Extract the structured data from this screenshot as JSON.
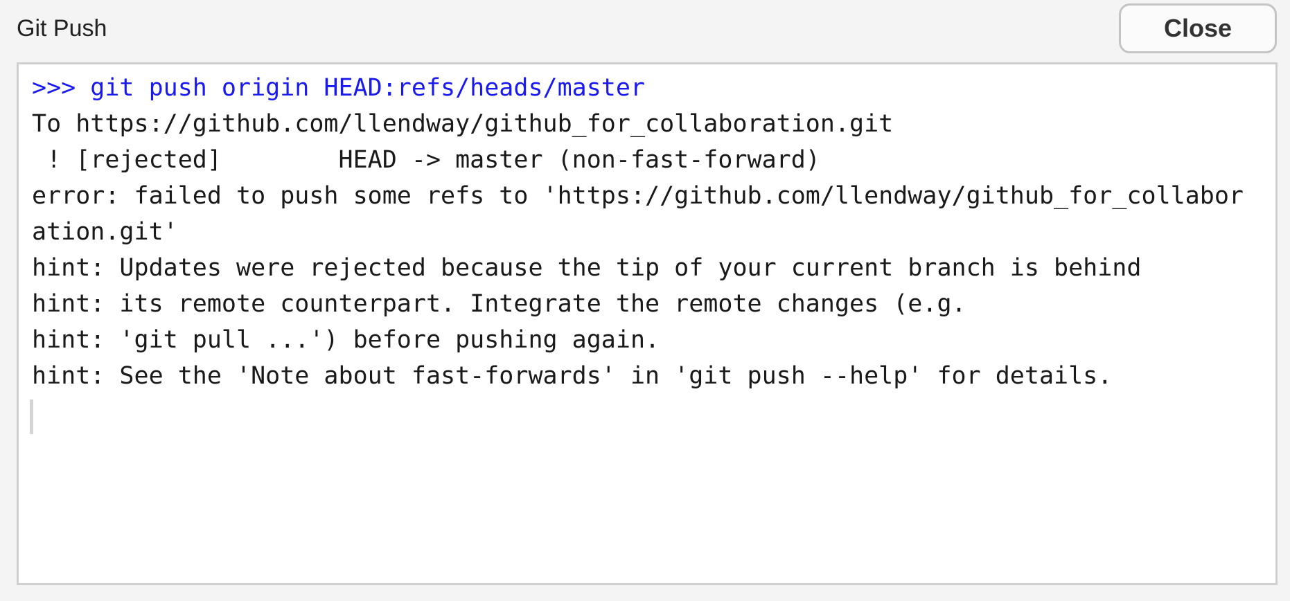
{
  "window": {
    "title": "Git Push",
    "close_label": "Close"
  },
  "output": {
    "lines": [
      {
        "text": ">>> git push origin HEAD:refs/heads/master",
        "type": "command"
      },
      {
        "text": "To https://github.com/llendway/github_for_collaboration.git",
        "type": "normal"
      },
      {
        "text": " ! [rejected]        HEAD -> master (non-fast-forward)",
        "type": "normal"
      },
      {
        "text": "error: failed to push some refs to 'https://github.com/llendway/github_for_collabor",
        "type": "normal"
      },
      {
        "text": "ation.git'",
        "type": "normal"
      },
      {
        "text": "hint: Updates were rejected because the tip of your current branch is behind",
        "type": "normal"
      },
      {
        "text": "hint: its remote counterpart. Integrate the remote changes (e.g.",
        "type": "normal"
      },
      {
        "text": "hint: 'git pull ...') before pushing again.",
        "type": "normal"
      },
      {
        "text": "hint: See the 'Note about fast-forwards' in 'git push --help' for details.",
        "type": "normal"
      }
    ],
    "colors": {
      "command": "#1a1aee",
      "normal": "#1a1a1a"
    }
  }
}
